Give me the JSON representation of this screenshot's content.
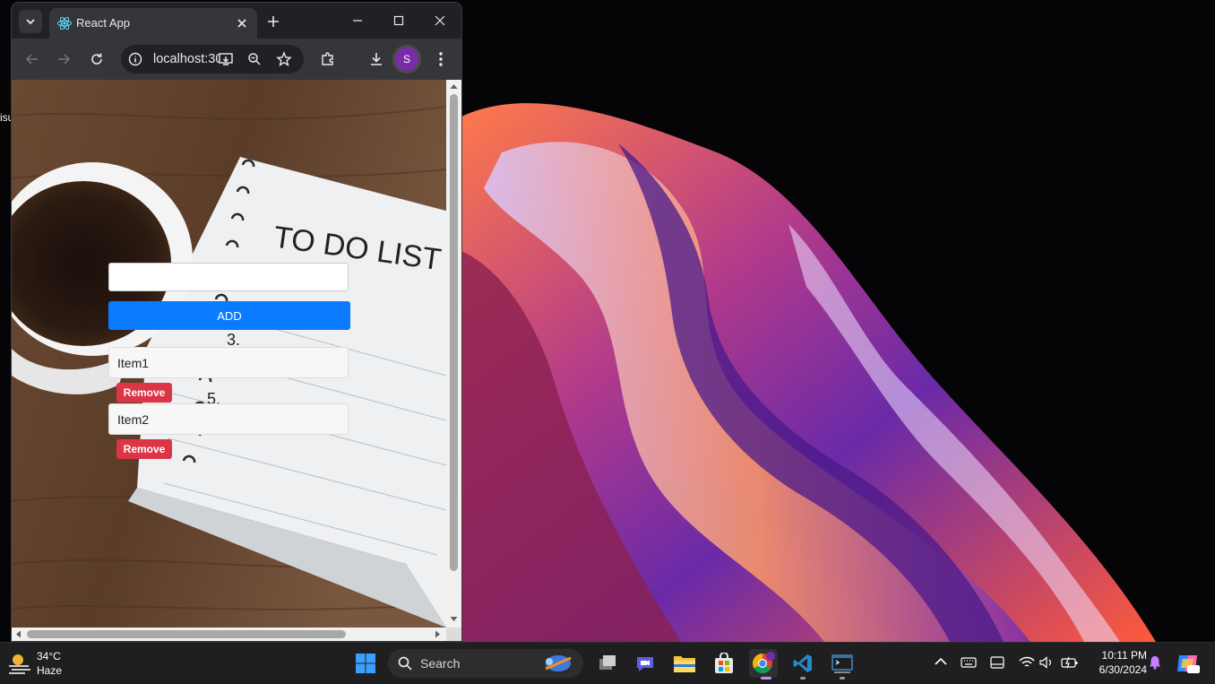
{
  "browser": {
    "tab_title": "React App",
    "url": "localhost:3000",
    "profile_initial": "S"
  },
  "todo": {
    "input_value": "",
    "add_label": "ADD",
    "items": [
      {
        "text": "Item1",
        "remove_label": "Remove"
      },
      {
        "text": "Item2",
        "remove_label": "Remove"
      }
    ]
  },
  "taskbar": {
    "weather_temp": "34°C",
    "weather_condition": "Haze",
    "search_label": "Search",
    "time": "10:11 PM",
    "date": "6/30/2024"
  },
  "colors": {
    "add_button": "#0a7bff",
    "remove_button": "#dc3545",
    "browser_frame": "#202124"
  }
}
